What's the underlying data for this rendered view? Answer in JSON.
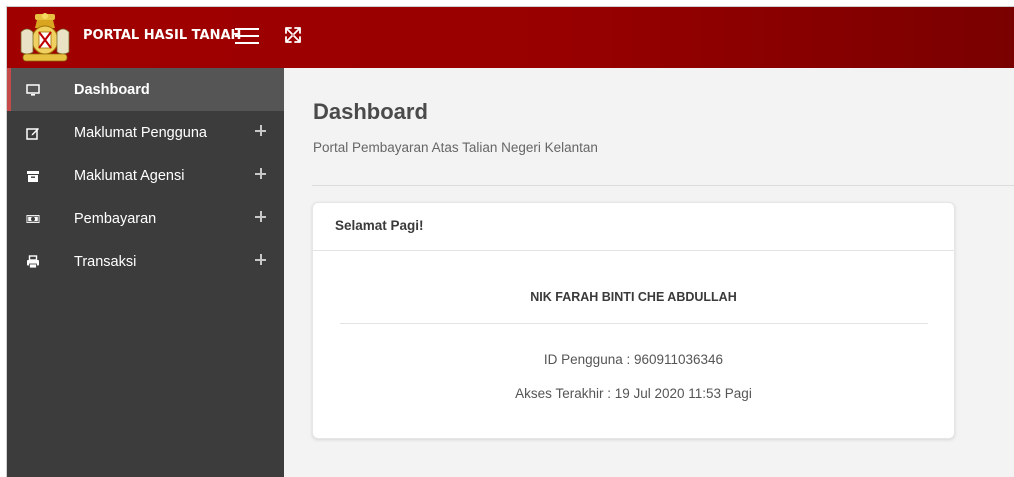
{
  "header": {
    "brand": "PORTAL HASIL TANAH",
    "logo_icon": "state-crest-icon",
    "menu_icon": "hamburger-menu-icon",
    "expand_icon": "fullscreen-expand-icon",
    "colors": {
      "topbar": "#a10000",
      "topbar_end": "#7a0000"
    }
  },
  "sidebar": {
    "background": "#3c3c3c",
    "active_accent": "#c54a4a",
    "items": [
      {
        "label": "Dashboard",
        "icon": "monitor-icon",
        "active": true,
        "expandable": false
      },
      {
        "label": "Maklumat Pengguna",
        "icon": "edit-icon",
        "active": false,
        "expandable": true
      },
      {
        "label": "Maklumat Agensi",
        "icon": "archive-box-icon",
        "active": false,
        "expandable": true
      },
      {
        "label": "Pembayaran",
        "icon": "money-bill-icon",
        "active": false,
        "expandable": true
      },
      {
        "label": "Transaksi",
        "icon": "printer-icon",
        "active": false,
        "expandable": true
      }
    ]
  },
  "main": {
    "title": "Dashboard",
    "subtitle": "Portal Pembayaran Atas Talian Negeri Kelantan",
    "card": {
      "title": "Selamat Pagi!",
      "user_name": "NIK FARAH BINTI CHE ABDULLAH",
      "user_id": "ID Pengguna : 960911036346",
      "last_access": "Akses Terakhir : 19 Jul 2020 11:53 Pagi"
    }
  }
}
